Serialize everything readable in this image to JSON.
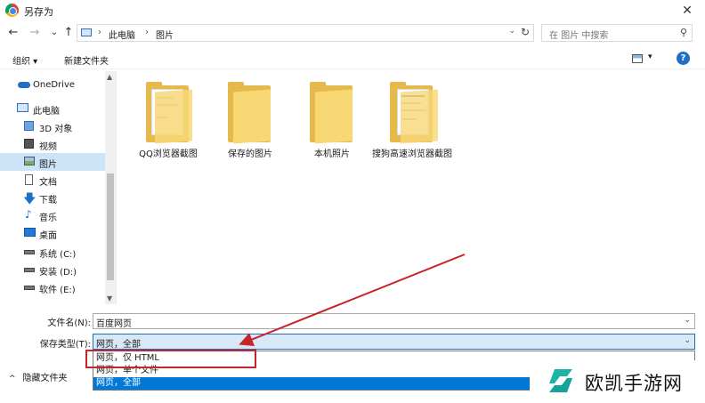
{
  "window": {
    "title": "另存为",
    "close_glyph": "✕"
  },
  "nav": {
    "back": "←",
    "forward": "→",
    "recent": "⌄",
    "up": "↑",
    "breadcrumbs": [
      "此电脑",
      "图片"
    ],
    "search_placeholder": "在 图片 中搜索"
  },
  "toolbar": {
    "organize": "组织 ▾",
    "new_folder": "新建文件夹",
    "help": "?"
  },
  "sidebar": {
    "items": [
      {
        "label": "OneDrive",
        "icon": "cloud-icon"
      },
      {
        "label": "此电脑",
        "icon": "computer-icon"
      },
      {
        "label": "3D 对象",
        "icon": "cube-icon"
      },
      {
        "label": "视频",
        "icon": "video-icon"
      },
      {
        "label": "图片",
        "icon": "pictures-icon",
        "selected": true
      },
      {
        "label": "文档",
        "icon": "document-icon"
      },
      {
        "label": "下载",
        "icon": "download-icon"
      },
      {
        "label": "音乐",
        "icon": "music-icon"
      },
      {
        "label": "桌面",
        "icon": "desktop-icon"
      },
      {
        "label": "系统 (C:)",
        "icon": "drive-icon"
      },
      {
        "label": "安装 (D:)",
        "icon": "drive-icon"
      },
      {
        "label": "软件 (E:)",
        "icon": "drive-icon"
      }
    ]
  },
  "folders": [
    {
      "name": "QQ浏览器截图",
      "has_content": true
    },
    {
      "name": "保存的图片",
      "has_content": false
    },
    {
      "name": "本机照片",
      "has_content": false
    },
    {
      "name": "搜狗高速浏览器截图",
      "has_content": true
    }
  ],
  "form": {
    "filename_label": "文件名(N):",
    "filename_value": "百度网页",
    "type_label": "保存类型(T):",
    "type_value": "网页，全部",
    "options": [
      "网页，仅 HTML",
      "网页，单个文件",
      "网页，全部"
    ],
    "selected_option": "网页，全部",
    "hide_folders": "隐藏文件夹"
  },
  "watermark": {
    "brand": "欧凯手游网"
  },
  "colors": {
    "accent": "#0078d7",
    "annotation": "#c8252b",
    "folder": "#f8d775",
    "selected_bg": "#cce4f7"
  }
}
